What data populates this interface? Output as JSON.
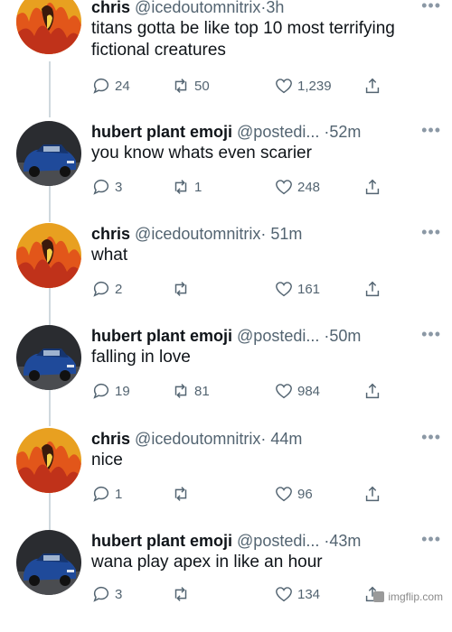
{
  "colors": {
    "text": "#0f1419",
    "secondary": "#536471",
    "thread_line": "#cfd9de"
  },
  "tweets": [
    {
      "name": "chris",
      "handle": "@icedoutomnitrix",
      "sep": "·",
      "time": "3h",
      "text": "titans gotta be like top 10 most terrifying fictional creatures",
      "replies": "24",
      "retweets": "50",
      "likes": "1,239",
      "avatar": "fire-avatar"
    },
    {
      "name": "hubert plant emoji",
      "handle": "@postedi...",
      "sep": "·",
      "time": "52m",
      "text": "you know whats even scarier",
      "replies": "3",
      "retweets": "1",
      "likes": "248",
      "avatar": "car-avatar"
    },
    {
      "name": "chris",
      "handle": "@icedoutomnitrix",
      "sep": "·",
      "time": "51m",
      "text": "what",
      "replies": "2",
      "retweets": "",
      "likes": "161",
      "avatar": "fire-avatar"
    },
    {
      "name": "hubert plant emoji",
      "handle": "@postedi...",
      "sep": "·",
      "time": "50m",
      "text": "falling in love",
      "replies": "19",
      "retweets": "81",
      "likes": "984",
      "avatar": "car-avatar"
    },
    {
      "name": "chris",
      "handle": "@icedoutomnitrix",
      "sep": "·",
      "time": "44m",
      "text": "nice",
      "replies": "1",
      "retweets": "",
      "likes": "96",
      "avatar": "fire-avatar"
    },
    {
      "name": "hubert plant emoji",
      "handle": "@postedi...",
      "sep": "·",
      "time": "43m",
      "text": "wana play apex in like an hour",
      "replies": "3",
      "retweets": "",
      "likes": "134",
      "avatar": "car-avatar"
    }
  ],
  "watermark": {
    "text": "imgflip.com"
  }
}
